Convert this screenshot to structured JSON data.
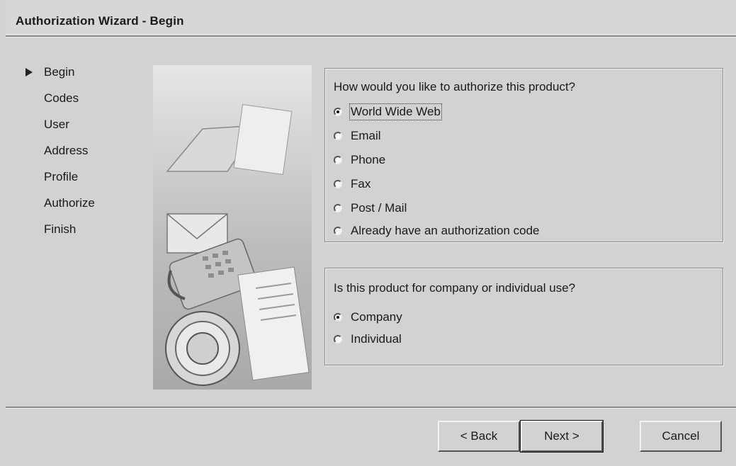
{
  "window": {
    "title": "Authorization Wizard - Begin"
  },
  "steps": [
    {
      "label": "Begin",
      "current": true
    },
    {
      "label": "Codes",
      "current": false
    },
    {
      "label": "User",
      "current": false
    },
    {
      "label": "Address",
      "current": false
    },
    {
      "label": "Profile",
      "current": false
    },
    {
      "label": "Authorize",
      "current": false
    },
    {
      "label": "Finish",
      "current": false
    }
  ],
  "method_group": {
    "question": "How would you like to authorize this product?",
    "options": [
      {
        "label": "World Wide Web",
        "selected": true
      },
      {
        "label": "Email",
        "selected": false
      },
      {
        "label": "Phone",
        "selected": false
      },
      {
        "label": "Fax",
        "selected": false
      },
      {
        "label": "Post / Mail",
        "selected": false
      },
      {
        "label": "Already have an authorization code",
        "selected": false
      }
    ]
  },
  "use_group": {
    "question": "Is this product for company or individual use?",
    "options": [
      {
        "label": "Company",
        "selected": true
      },
      {
        "label": "Individual",
        "selected": false
      }
    ]
  },
  "buttons": {
    "back": "< Back",
    "next": "Next >",
    "cancel": "Cancel"
  }
}
